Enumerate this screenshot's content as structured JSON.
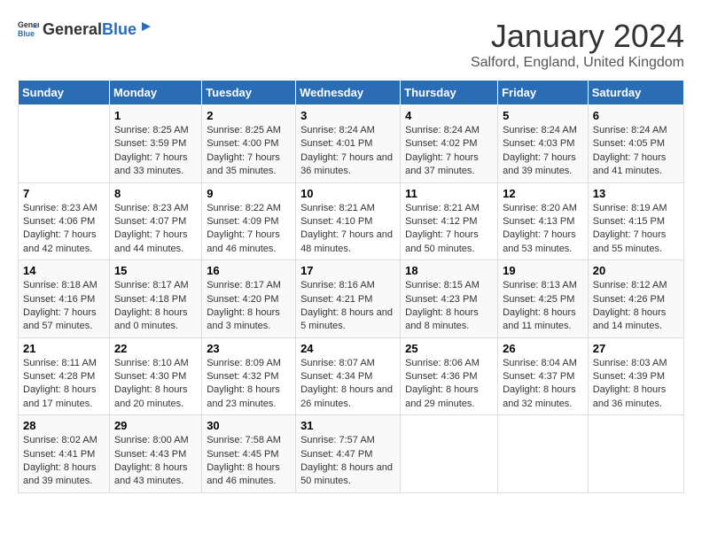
{
  "header": {
    "logo_general": "General",
    "logo_blue": "Blue",
    "month": "January 2024",
    "location": "Salford, England, United Kingdom"
  },
  "days_of_week": [
    "Sunday",
    "Monday",
    "Tuesday",
    "Wednesday",
    "Thursday",
    "Friday",
    "Saturday"
  ],
  "weeks": [
    [
      {
        "day": "",
        "sunrise": "",
        "sunset": "",
        "daylight": ""
      },
      {
        "day": "1",
        "sunrise": "8:25 AM",
        "sunset": "3:59 PM",
        "daylight": "7 hours and 33 minutes."
      },
      {
        "day": "2",
        "sunrise": "8:25 AM",
        "sunset": "4:00 PM",
        "daylight": "7 hours and 35 minutes."
      },
      {
        "day": "3",
        "sunrise": "8:24 AM",
        "sunset": "4:01 PM",
        "daylight": "7 hours and 36 minutes."
      },
      {
        "day": "4",
        "sunrise": "8:24 AM",
        "sunset": "4:02 PM",
        "daylight": "7 hours and 37 minutes."
      },
      {
        "day": "5",
        "sunrise": "8:24 AM",
        "sunset": "4:03 PM",
        "daylight": "7 hours and 39 minutes."
      },
      {
        "day": "6",
        "sunrise": "8:24 AM",
        "sunset": "4:05 PM",
        "daylight": "7 hours and 41 minutes."
      }
    ],
    [
      {
        "day": "7",
        "sunrise": "8:23 AM",
        "sunset": "4:06 PM",
        "daylight": "7 hours and 42 minutes."
      },
      {
        "day": "8",
        "sunrise": "8:23 AM",
        "sunset": "4:07 PM",
        "daylight": "7 hours and 44 minutes."
      },
      {
        "day": "9",
        "sunrise": "8:22 AM",
        "sunset": "4:09 PM",
        "daylight": "7 hours and 46 minutes."
      },
      {
        "day": "10",
        "sunrise": "8:21 AM",
        "sunset": "4:10 PM",
        "daylight": "7 hours and 48 minutes."
      },
      {
        "day": "11",
        "sunrise": "8:21 AM",
        "sunset": "4:12 PM",
        "daylight": "7 hours and 50 minutes."
      },
      {
        "day": "12",
        "sunrise": "8:20 AM",
        "sunset": "4:13 PM",
        "daylight": "7 hours and 53 minutes."
      },
      {
        "day": "13",
        "sunrise": "8:19 AM",
        "sunset": "4:15 PM",
        "daylight": "7 hours and 55 minutes."
      }
    ],
    [
      {
        "day": "14",
        "sunrise": "8:18 AM",
        "sunset": "4:16 PM",
        "daylight": "7 hours and 57 minutes."
      },
      {
        "day": "15",
        "sunrise": "8:17 AM",
        "sunset": "4:18 PM",
        "daylight": "8 hours and 0 minutes."
      },
      {
        "day": "16",
        "sunrise": "8:17 AM",
        "sunset": "4:20 PM",
        "daylight": "8 hours and 3 minutes."
      },
      {
        "day": "17",
        "sunrise": "8:16 AM",
        "sunset": "4:21 PM",
        "daylight": "8 hours and 5 minutes."
      },
      {
        "day": "18",
        "sunrise": "8:15 AM",
        "sunset": "4:23 PM",
        "daylight": "8 hours and 8 minutes."
      },
      {
        "day": "19",
        "sunrise": "8:13 AM",
        "sunset": "4:25 PM",
        "daylight": "8 hours and 11 minutes."
      },
      {
        "day": "20",
        "sunrise": "8:12 AM",
        "sunset": "4:26 PM",
        "daylight": "8 hours and 14 minutes."
      }
    ],
    [
      {
        "day": "21",
        "sunrise": "8:11 AM",
        "sunset": "4:28 PM",
        "daylight": "8 hours and 17 minutes."
      },
      {
        "day": "22",
        "sunrise": "8:10 AM",
        "sunset": "4:30 PM",
        "daylight": "8 hours and 20 minutes."
      },
      {
        "day": "23",
        "sunrise": "8:09 AM",
        "sunset": "4:32 PM",
        "daylight": "8 hours and 23 minutes."
      },
      {
        "day": "24",
        "sunrise": "8:07 AM",
        "sunset": "4:34 PM",
        "daylight": "8 hours and 26 minutes."
      },
      {
        "day": "25",
        "sunrise": "8:06 AM",
        "sunset": "4:36 PM",
        "daylight": "8 hours and 29 minutes."
      },
      {
        "day": "26",
        "sunrise": "8:04 AM",
        "sunset": "4:37 PM",
        "daylight": "8 hours and 32 minutes."
      },
      {
        "day": "27",
        "sunrise": "8:03 AM",
        "sunset": "4:39 PM",
        "daylight": "8 hours and 36 minutes."
      }
    ],
    [
      {
        "day": "28",
        "sunrise": "8:02 AM",
        "sunset": "4:41 PM",
        "daylight": "8 hours and 39 minutes."
      },
      {
        "day": "29",
        "sunrise": "8:00 AM",
        "sunset": "4:43 PM",
        "daylight": "8 hours and 43 minutes."
      },
      {
        "day": "30",
        "sunrise": "7:58 AM",
        "sunset": "4:45 PM",
        "daylight": "8 hours and 46 minutes."
      },
      {
        "day": "31",
        "sunrise": "7:57 AM",
        "sunset": "4:47 PM",
        "daylight": "8 hours and 50 minutes."
      },
      {
        "day": "",
        "sunrise": "",
        "sunset": "",
        "daylight": ""
      },
      {
        "day": "",
        "sunrise": "",
        "sunset": "",
        "daylight": ""
      },
      {
        "day": "",
        "sunrise": "",
        "sunset": "",
        "daylight": ""
      }
    ]
  ],
  "labels": {
    "sunrise_prefix": "Sunrise:",
    "sunset_prefix": "Sunset:",
    "daylight_prefix": "Daylight:"
  }
}
